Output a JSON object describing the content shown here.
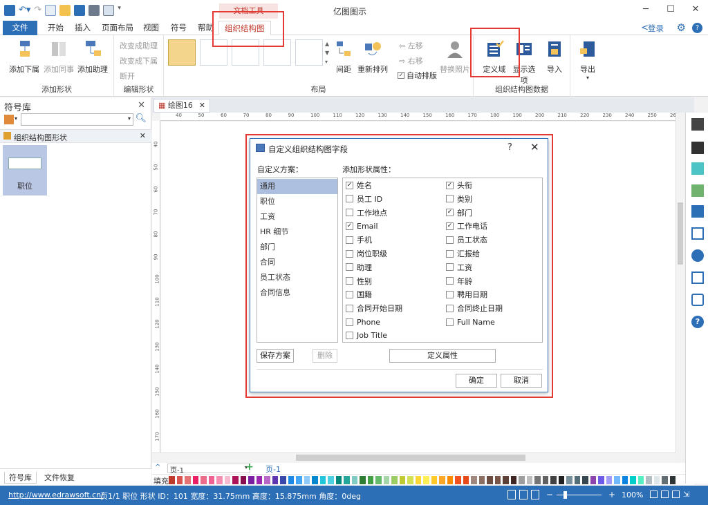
{
  "app": {
    "title": "亿图图示",
    "context_tab_group": "文档工具"
  },
  "tabs": [
    "文件",
    "开始",
    "插入",
    "页面布局",
    "视图",
    "符号",
    "帮助",
    "组织结构图"
  ],
  "header": {
    "login": "登录"
  },
  "ribbon": {
    "add_shape": {
      "label": "添加形状",
      "add_subordinate": "添加下属",
      "add_colleague": "添加同事",
      "add_assistant": "添加助理"
    },
    "edit_shape": {
      "label": "编辑形状",
      "to_assistant": "改变成助理",
      "to_subordinate": "改变成下属",
      "disconnect": "断开"
    },
    "layout": {
      "label": "布局",
      "spacing": "间距",
      "rearrange": "重新排列",
      "move_left": "左移",
      "move_right": "右移",
      "auto_layout": "自动排版",
      "replace_photo": "替换照片"
    },
    "org_data": {
      "label": "组织结构图数据",
      "define_field": "定义域",
      "display_options": "显示选项",
      "import": "导入"
    },
    "export": "导出"
  },
  "left_panel": {
    "title": "符号库",
    "library": "组织结构图形状",
    "shape_label": "职位",
    "tabs": [
      "符号库",
      "文件恢复"
    ]
  },
  "document": {
    "tab": "绘图16",
    "page_selector": "页-1",
    "page_tab": "页-1",
    "fill_label": "填充",
    "hruler": [
      "40",
      "50",
      "60",
      "70",
      "80",
      "90",
      "100",
      "110",
      "120",
      "130",
      "140",
      "150",
      "160",
      "170",
      "180",
      "190",
      "200",
      "210",
      "220",
      "230",
      "240",
      "250",
      "260"
    ],
    "vruler": [
      "40",
      "50",
      "60",
      "70",
      "80",
      "90",
      "100",
      "110",
      "120",
      "130",
      "140",
      "150",
      "160",
      "170"
    ]
  },
  "dialog": {
    "title": "自定义组织结构图字段",
    "help": "?",
    "scheme_label": "自定义方案：",
    "fields_label": "添加形状属性：",
    "schemes": [
      "通用",
      "职位",
      "工资",
      "HR 细节",
      "部门",
      "合同",
      "员工状态",
      "合同信息"
    ],
    "fields_left": [
      {
        "label": "姓名",
        "checked": true
      },
      {
        "label": "员工 ID",
        "checked": false
      },
      {
        "label": "工作地点",
        "checked": false
      },
      {
        "label": "Email",
        "checked": true
      },
      {
        "label": "手机",
        "checked": false
      },
      {
        "label": "岗位职级",
        "checked": false
      },
      {
        "label": "助理",
        "checked": false
      },
      {
        "label": "性别",
        "checked": false
      },
      {
        "label": "国籍",
        "checked": false
      },
      {
        "label": "合同开始日期",
        "checked": false
      },
      {
        "label": "Phone",
        "checked": false
      },
      {
        "label": "Job Title",
        "checked": false
      }
    ],
    "fields_right": [
      {
        "label": "头衔",
        "checked": true
      },
      {
        "label": "类别",
        "checked": false
      },
      {
        "label": "部门",
        "checked": true
      },
      {
        "label": "工作电话",
        "checked": true
      },
      {
        "label": "员工状态",
        "checked": false
      },
      {
        "label": "汇报给",
        "checked": false
      },
      {
        "label": "工资",
        "checked": false
      },
      {
        "label": "年龄",
        "checked": false
      },
      {
        "label": "聘用日期",
        "checked": false
      },
      {
        "label": "合同终止日期",
        "checked": false
      },
      {
        "label": "Full Name",
        "checked": false
      }
    ],
    "save_scheme": "保存方案",
    "delete": "删除",
    "define_property": "定义属性",
    "ok": "确定",
    "cancel": "取消"
  },
  "status": {
    "url": "http://www.edrawsoft.cn/",
    "info": "页1/1  职位  形状 ID：101  宽度：31.75mm  高度：15.875mm  角度：0deg",
    "zoom": "100%"
  },
  "palette": [
    "#c0392b",
    "#d9534f",
    "#e57373",
    "#e91e63",
    "#ec6d8a",
    "#f06292",
    "#f48fb1",
    "#f8bbd0",
    "#ad1457",
    "#880e4f",
    "#7b1fa2",
    "#9c27b0",
    "#ba68c8",
    "#5e35b1",
    "#3949ab",
    "#1e88e5",
    "#42a5f5",
    "#90caf9",
    "#0288d1",
    "#26c6da",
    "#4dd0e1",
    "#00897b",
    "#26a69a",
    "#80cbc4",
    "#2e7d32",
    "#43a047",
    "#66bb6a",
    "#a5d6a7",
    "#9ccc65",
    "#c0ca33",
    "#d4e157",
    "#fdd835",
    "#ffee58",
    "#ffca28",
    "#ffa726",
    "#fb8c00",
    "#f4511e",
    "#e64a19",
    "#a1887f",
    "#8d6e63",
    "#6d4c41",
    "#795548",
    "#5d4037",
    "#3e2723",
    "#9e9e9e",
    "#bdbdbd",
    "#757575",
    "#616161",
    "#424242",
    "#212121",
    "#78909c",
    "#546e7a",
    "#37474f",
    "#8e44ad",
    "#6c5ce7",
    "#a29bfe",
    "#74b9ff",
    "#0984e3",
    "#00cec9",
    "#55efc4",
    "#b2bec3",
    "#dfe6e9",
    "#636e72",
    "#2d3436"
  ]
}
